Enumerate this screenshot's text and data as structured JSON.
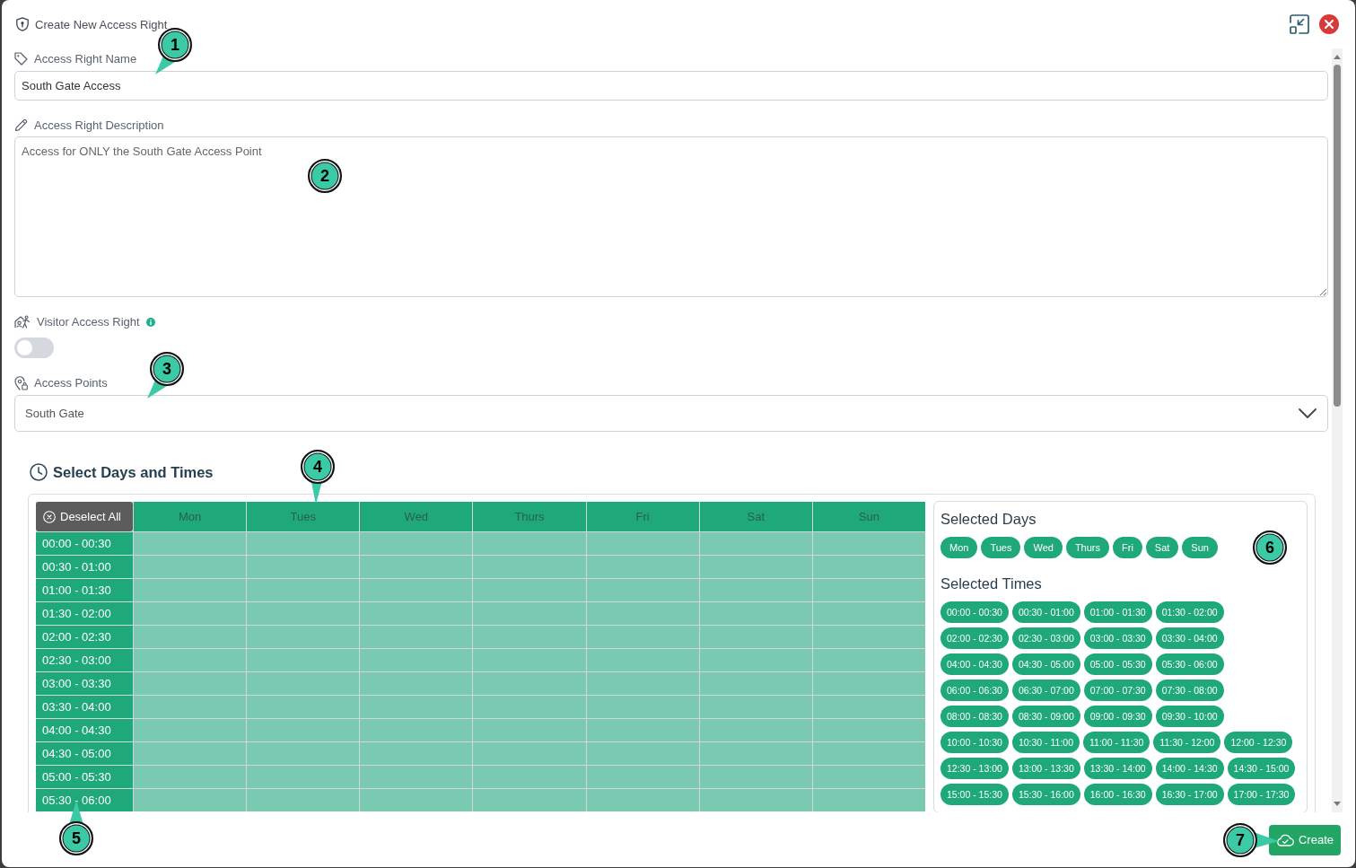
{
  "header": {
    "title": "Create New Access Right"
  },
  "form": {
    "name_field": {
      "label": "Access Right Name",
      "value": "South Gate Access"
    },
    "description_field": {
      "label": "Access Right Description",
      "value": "Access for ONLY the South Gate Access Point"
    },
    "visitor_toggle": {
      "label": "Visitor Access Right",
      "on": false
    },
    "access_points": {
      "label": "Access Points",
      "value": "South Gate"
    }
  },
  "schedule": {
    "title": "Select Days and Times",
    "deselect_button": "Deselect All",
    "days": [
      "Mon",
      "Tues",
      "Wed",
      "Thurs",
      "Fri",
      "Sat",
      "Sun"
    ],
    "rows": [
      {
        "time": "00:00 - 00:30",
        "cells": [
          {
            "selected": true
          },
          {
            "selected": true
          },
          {
            "selected": true
          },
          {
            "selected": true
          },
          {
            "selected": true
          },
          {
            "selected": true
          },
          {
            "selected": true
          }
        ]
      },
      {
        "time": "00:30 - 01:00",
        "cells": [
          {
            "selected": true
          },
          {
            "selected": true
          },
          {
            "selected": true
          },
          {
            "selected": true
          },
          {
            "selected": true
          },
          {
            "selected": true
          },
          {
            "selected": true
          }
        ]
      },
      {
        "time": "01:00 - 01:30",
        "cells": [
          {
            "selected": true
          },
          {
            "selected": true
          },
          {
            "selected": true
          },
          {
            "selected": true
          },
          {
            "selected": true
          },
          {
            "selected": true
          },
          {
            "selected": true
          }
        ]
      },
      {
        "time": "01:30 - 02:00",
        "cells": [
          {
            "selected": true
          },
          {
            "selected": true
          },
          {
            "selected": true
          },
          {
            "selected": true
          },
          {
            "selected": true
          },
          {
            "selected": true
          },
          {
            "selected": true
          }
        ]
      },
      {
        "time": "02:00 - 02:30",
        "cells": [
          {
            "selected": true
          },
          {
            "selected": true
          },
          {
            "selected": true
          },
          {
            "selected": true
          },
          {
            "selected": true
          },
          {
            "selected": true
          },
          {
            "selected": true
          }
        ]
      },
      {
        "time": "02:30 - 03:00",
        "cells": [
          {
            "selected": true
          },
          {
            "selected": true
          },
          {
            "selected": true
          },
          {
            "selected": true
          },
          {
            "selected": true
          },
          {
            "selected": true
          },
          {
            "selected": true
          }
        ]
      },
      {
        "time": "03:00 - 03:30",
        "cells": [
          {
            "selected": true
          },
          {
            "selected": true
          },
          {
            "selected": true
          },
          {
            "selected": true
          },
          {
            "selected": true
          },
          {
            "selected": true
          },
          {
            "selected": true
          }
        ]
      },
      {
        "time": "03:30 - 04:00",
        "cells": [
          {
            "selected": true
          },
          {
            "selected": true
          },
          {
            "selected": true
          },
          {
            "selected": true
          },
          {
            "selected": true
          },
          {
            "selected": true
          },
          {
            "selected": true
          }
        ]
      },
      {
        "time": "04:00 - 04:30",
        "cells": [
          {
            "selected": true
          },
          {
            "selected": true
          },
          {
            "selected": true
          },
          {
            "selected": true
          },
          {
            "selected": true
          },
          {
            "selected": true
          },
          {
            "selected": true
          }
        ]
      },
      {
        "time": "04:30 - 05:00",
        "cells": [
          {
            "selected": true
          },
          {
            "selected": true
          },
          {
            "selected": true
          },
          {
            "selected": true
          },
          {
            "selected": true
          },
          {
            "selected": true
          },
          {
            "selected": true
          }
        ]
      },
      {
        "time": "05:00 - 05:30",
        "cells": [
          {
            "selected": true
          },
          {
            "selected": true
          },
          {
            "selected": true
          },
          {
            "selected": true
          },
          {
            "selected": true
          },
          {
            "selected": true
          },
          {
            "selected": true
          }
        ]
      },
      {
        "time": "05:30 - 06:00",
        "cells": [
          {
            "selected": true
          },
          {
            "selected": true
          },
          {
            "selected": true
          },
          {
            "selected": true
          },
          {
            "selected": true
          },
          {
            "selected": true
          },
          {
            "selected": true
          }
        ]
      }
    ],
    "selected_days": {
      "title": "Selected Days",
      "tags": [
        "Mon",
        "Tues",
        "Wed",
        "Thurs",
        "Fri",
        "Sat",
        "Sun"
      ]
    },
    "selected_times": {
      "title": "Selected Times",
      "rows": [
        [
          "00:00 - 00:30",
          "00:30 - 01:00",
          "01:00 - 01:30",
          "01:30 - 02:00"
        ],
        [
          "02:00 - 02:30",
          "02:30 - 03:00",
          "03:00 - 03:30",
          "03:30 - 04:00"
        ],
        [
          "04:00 - 04:30",
          "04:30 - 05:00",
          "05:00 - 05:30",
          "05:30 - 06:00"
        ],
        [
          "06:00 - 06:30",
          "06:30 - 07:00",
          "07:00 - 07:30",
          "07:30 - 08:00"
        ],
        [
          "08:00 - 08:30",
          "08:30 - 09:00",
          "09:00 - 09:30",
          "09:30 - 10:00"
        ],
        [
          "10:00 - 10:30",
          "10:30 - 11:00",
          "11:00 - 11:30",
          "11:30 - 12:00",
          "12:00 - 12:30"
        ],
        [
          "12:30 - 13:00",
          "13:00 - 13:30",
          "13:30 - 14:00",
          "14:00 - 14:30",
          "14:30 - 15:00"
        ],
        [
          "15:00 - 15:30",
          "15:30 - 16:00",
          "16:00 - 16:30",
          "16:30 - 17:00",
          "17:00 - 17:30"
        ]
      ]
    }
  },
  "footer": {
    "create_button": "Create"
  },
  "callouts": [
    {
      "number": "1"
    },
    {
      "number": "2"
    },
    {
      "number": "3"
    },
    {
      "number": "4"
    },
    {
      "number": "5"
    },
    {
      "number": "6"
    },
    {
      "number": "7"
    }
  ]
}
